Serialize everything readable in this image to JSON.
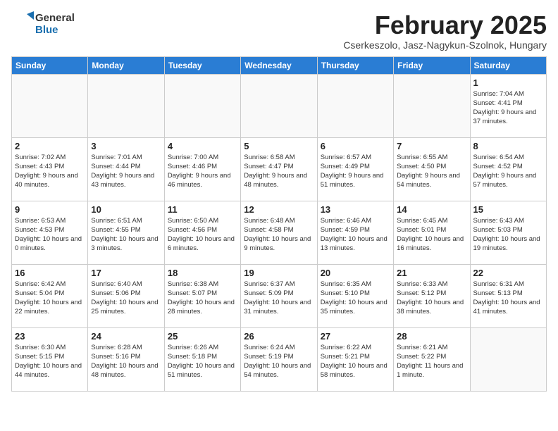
{
  "header": {
    "logo_general": "General",
    "logo_blue": "Blue",
    "month_title": "February 2025",
    "subtitle": "Cserkeszolo, Jasz-Nagykun-Szolnok, Hungary"
  },
  "weekdays": [
    "Sunday",
    "Monday",
    "Tuesday",
    "Wednesday",
    "Thursday",
    "Friday",
    "Saturday"
  ],
  "weeks": [
    [
      {
        "day": "",
        "info": ""
      },
      {
        "day": "",
        "info": ""
      },
      {
        "day": "",
        "info": ""
      },
      {
        "day": "",
        "info": ""
      },
      {
        "day": "",
        "info": ""
      },
      {
        "day": "",
        "info": ""
      },
      {
        "day": "1",
        "info": "Sunrise: 7:04 AM\nSunset: 4:41 PM\nDaylight: 9 hours and 37 minutes."
      }
    ],
    [
      {
        "day": "2",
        "info": "Sunrise: 7:02 AM\nSunset: 4:43 PM\nDaylight: 9 hours and 40 minutes."
      },
      {
        "day": "3",
        "info": "Sunrise: 7:01 AM\nSunset: 4:44 PM\nDaylight: 9 hours and 43 minutes."
      },
      {
        "day": "4",
        "info": "Sunrise: 7:00 AM\nSunset: 4:46 PM\nDaylight: 9 hours and 46 minutes."
      },
      {
        "day": "5",
        "info": "Sunrise: 6:58 AM\nSunset: 4:47 PM\nDaylight: 9 hours and 48 minutes."
      },
      {
        "day": "6",
        "info": "Sunrise: 6:57 AM\nSunset: 4:49 PM\nDaylight: 9 hours and 51 minutes."
      },
      {
        "day": "7",
        "info": "Sunrise: 6:55 AM\nSunset: 4:50 PM\nDaylight: 9 hours and 54 minutes."
      },
      {
        "day": "8",
        "info": "Sunrise: 6:54 AM\nSunset: 4:52 PM\nDaylight: 9 hours and 57 minutes."
      }
    ],
    [
      {
        "day": "9",
        "info": "Sunrise: 6:53 AM\nSunset: 4:53 PM\nDaylight: 10 hours and 0 minutes."
      },
      {
        "day": "10",
        "info": "Sunrise: 6:51 AM\nSunset: 4:55 PM\nDaylight: 10 hours and 3 minutes."
      },
      {
        "day": "11",
        "info": "Sunrise: 6:50 AM\nSunset: 4:56 PM\nDaylight: 10 hours and 6 minutes."
      },
      {
        "day": "12",
        "info": "Sunrise: 6:48 AM\nSunset: 4:58 PM\nDaylight: 10 hours and 9 minutes."
      },
      {
        "day": "13",
        "info": "Sunrise: 6:46 AM\nSunset: 4:59 PM\nDaylight: 10 hours and 13 minutes."
      },
      {
        "day": "14",
        "info": "Sunrise: 6:45 AM\nSunset: 5:01 PM\nDaylight: 10 hours and 16 minutes."
      },
      {
        "day": "15",
        "info": "Sunrise: 6:43 AM\nSunset: 5:03 PM\nDaylight: 10 hours and 19 minutes."
      }
    ],
    [
      {
        "day": "16",
        "info": "Sunrise: 6:42 AM\nSunset: 5:04 PM\nDaylight: 10 hours and 22 minutes."
      },
      {
        "day": "17",
        "info": "Sunrise: 6:40 AM\nSunset: 5:06 PM\nDaylight: 10 hours and 25 minutes."
      },
      {
        "day": "18",
        "info": "Sunrise: 6:38 AM\nSunset: 5:07 PM\nDaylight: 10 hours and 28 minutes."
      },
      {
        "day": "19",
        "info": "Sunrise: 6:37 AM\nSunset: 5:09 PM\nDaylight: 10 hours and 31 minutes."
      },
      {
        "day": "20",
        "info": "Sunrise: 6:35 AM\nSunset: 5:10 PM\nDaylight: 10 hours and 35 minutes."
      },
      {
        "day": "21",
        "info": "Sunrise: 6:33 AM\nSunset: 5:12 PM\nDaylight: 10 hours and 38 minutes."
      },
      {
        "day": "22",
        "info": "Sunrise: 6:31 AM\nSunset: 5:13 PM\nDaylight: 10 hours and 41 minutes."
      }
    ],
    [
      {
        "day": "23",
        "info": "Sunrise: 6:30 AM\nSunset: 5:15 PM\nDaylight: 10 hours and 44 minutes."
      },
      {
        "day": "24",
        "info": "Sunrise: 6:28 AM\nSunset: 5:16 PM\nDaylight: 10 hours and 48 minutes."
      },
      {
        "day": "25",
        "info": "Sunrise: 6:26 AM\nSunset: 5:18 PM\nDaylight: 10 hours and 51 minutes."
      },
      {
        "day": "26",
        "info": "Sunrise: 6:24 AM\nSunset: 5:19 PM\nDaylight: 10 hours and 54 minutes."
      },
      {
        "day": "27",
        "info": "Sunrise: 6:22 AM\nSunset: 5:21 PM\nDaylight: 10 hours and 58 minutes."
      },
      {
        "day": "28",
        "info": "Sunrise: 6:21 AM\nSunset: 5:22 PM\nDaylight: 11 hours and 1 minute."
      },
      {
        "day": "",
        "info": ""
      }
    ]
  ]
}
